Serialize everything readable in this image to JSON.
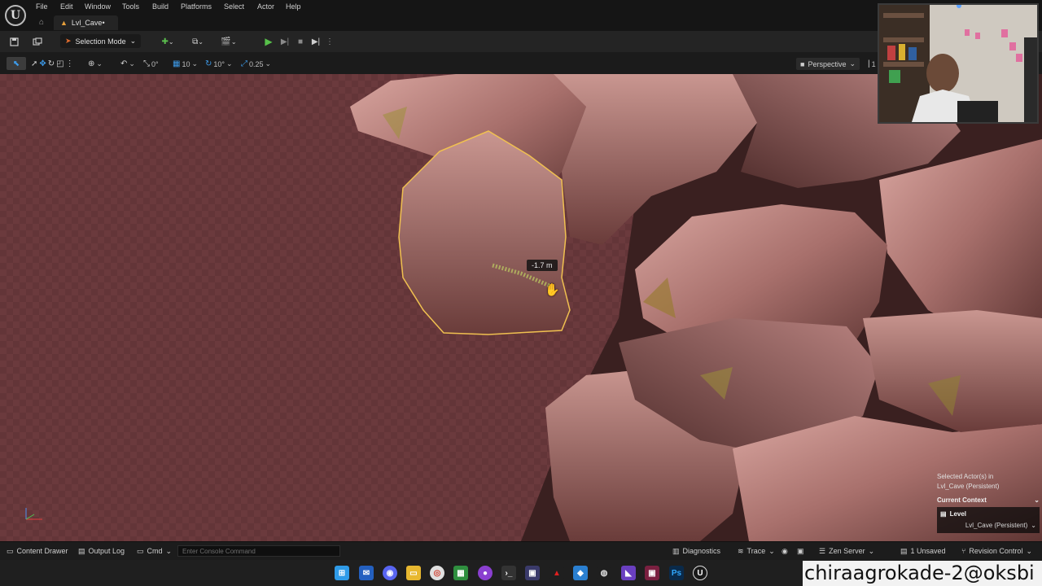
{
  "menu": {
    "items": [
      "File",
      "Edit",
      "Window",
      "Tools",
      "Build",
      "Platforms",
      "Select",
      "Actor",
      "Help"
    ]
  },
  "tab": {
    "title": "Lvl_Cave•"
  },
  "toolbar": {
    "selection_mode": "Selection Mode"
  },
  "viewport_toolbar": {
    "rotation_snap": "0°",
    "grid_snap": "10",
    "angle_snap": "10°",
    "scale_snap": "0.25",
    "view_mode": "Perspective",
    "view_overflow": "1"
  },
  "viewport": {
    "distance_readout": "-1.7 m",
    "selection_color": "#f0c050"
  },
  "actor_info": {
    "selected_label": "Selected Actor(s) in",
    "selected_level": "Lvl_Cave (Persistent)",
    "context_header": "Current Context",
    "context_level_label": "Level",
    "context_level_value": "Lvl_Cave (Persistent)"
  },
  "statusbar": {
    "content_drawer": "Content Drawer",
    "output_log": "Output Log",
    "cmd": "Cmd",
    "console_placeholder": "Enter Console Command",
    "diagnostics": "Diagnostics",
    "trace": "Trace",
    "zen_server": "Zen Server",
    "unsaved": "1 Unsaved",
    "revision_control": "Revision Control"
  },
  "watermark": "chiraagrokade-2@oksbi"
}
